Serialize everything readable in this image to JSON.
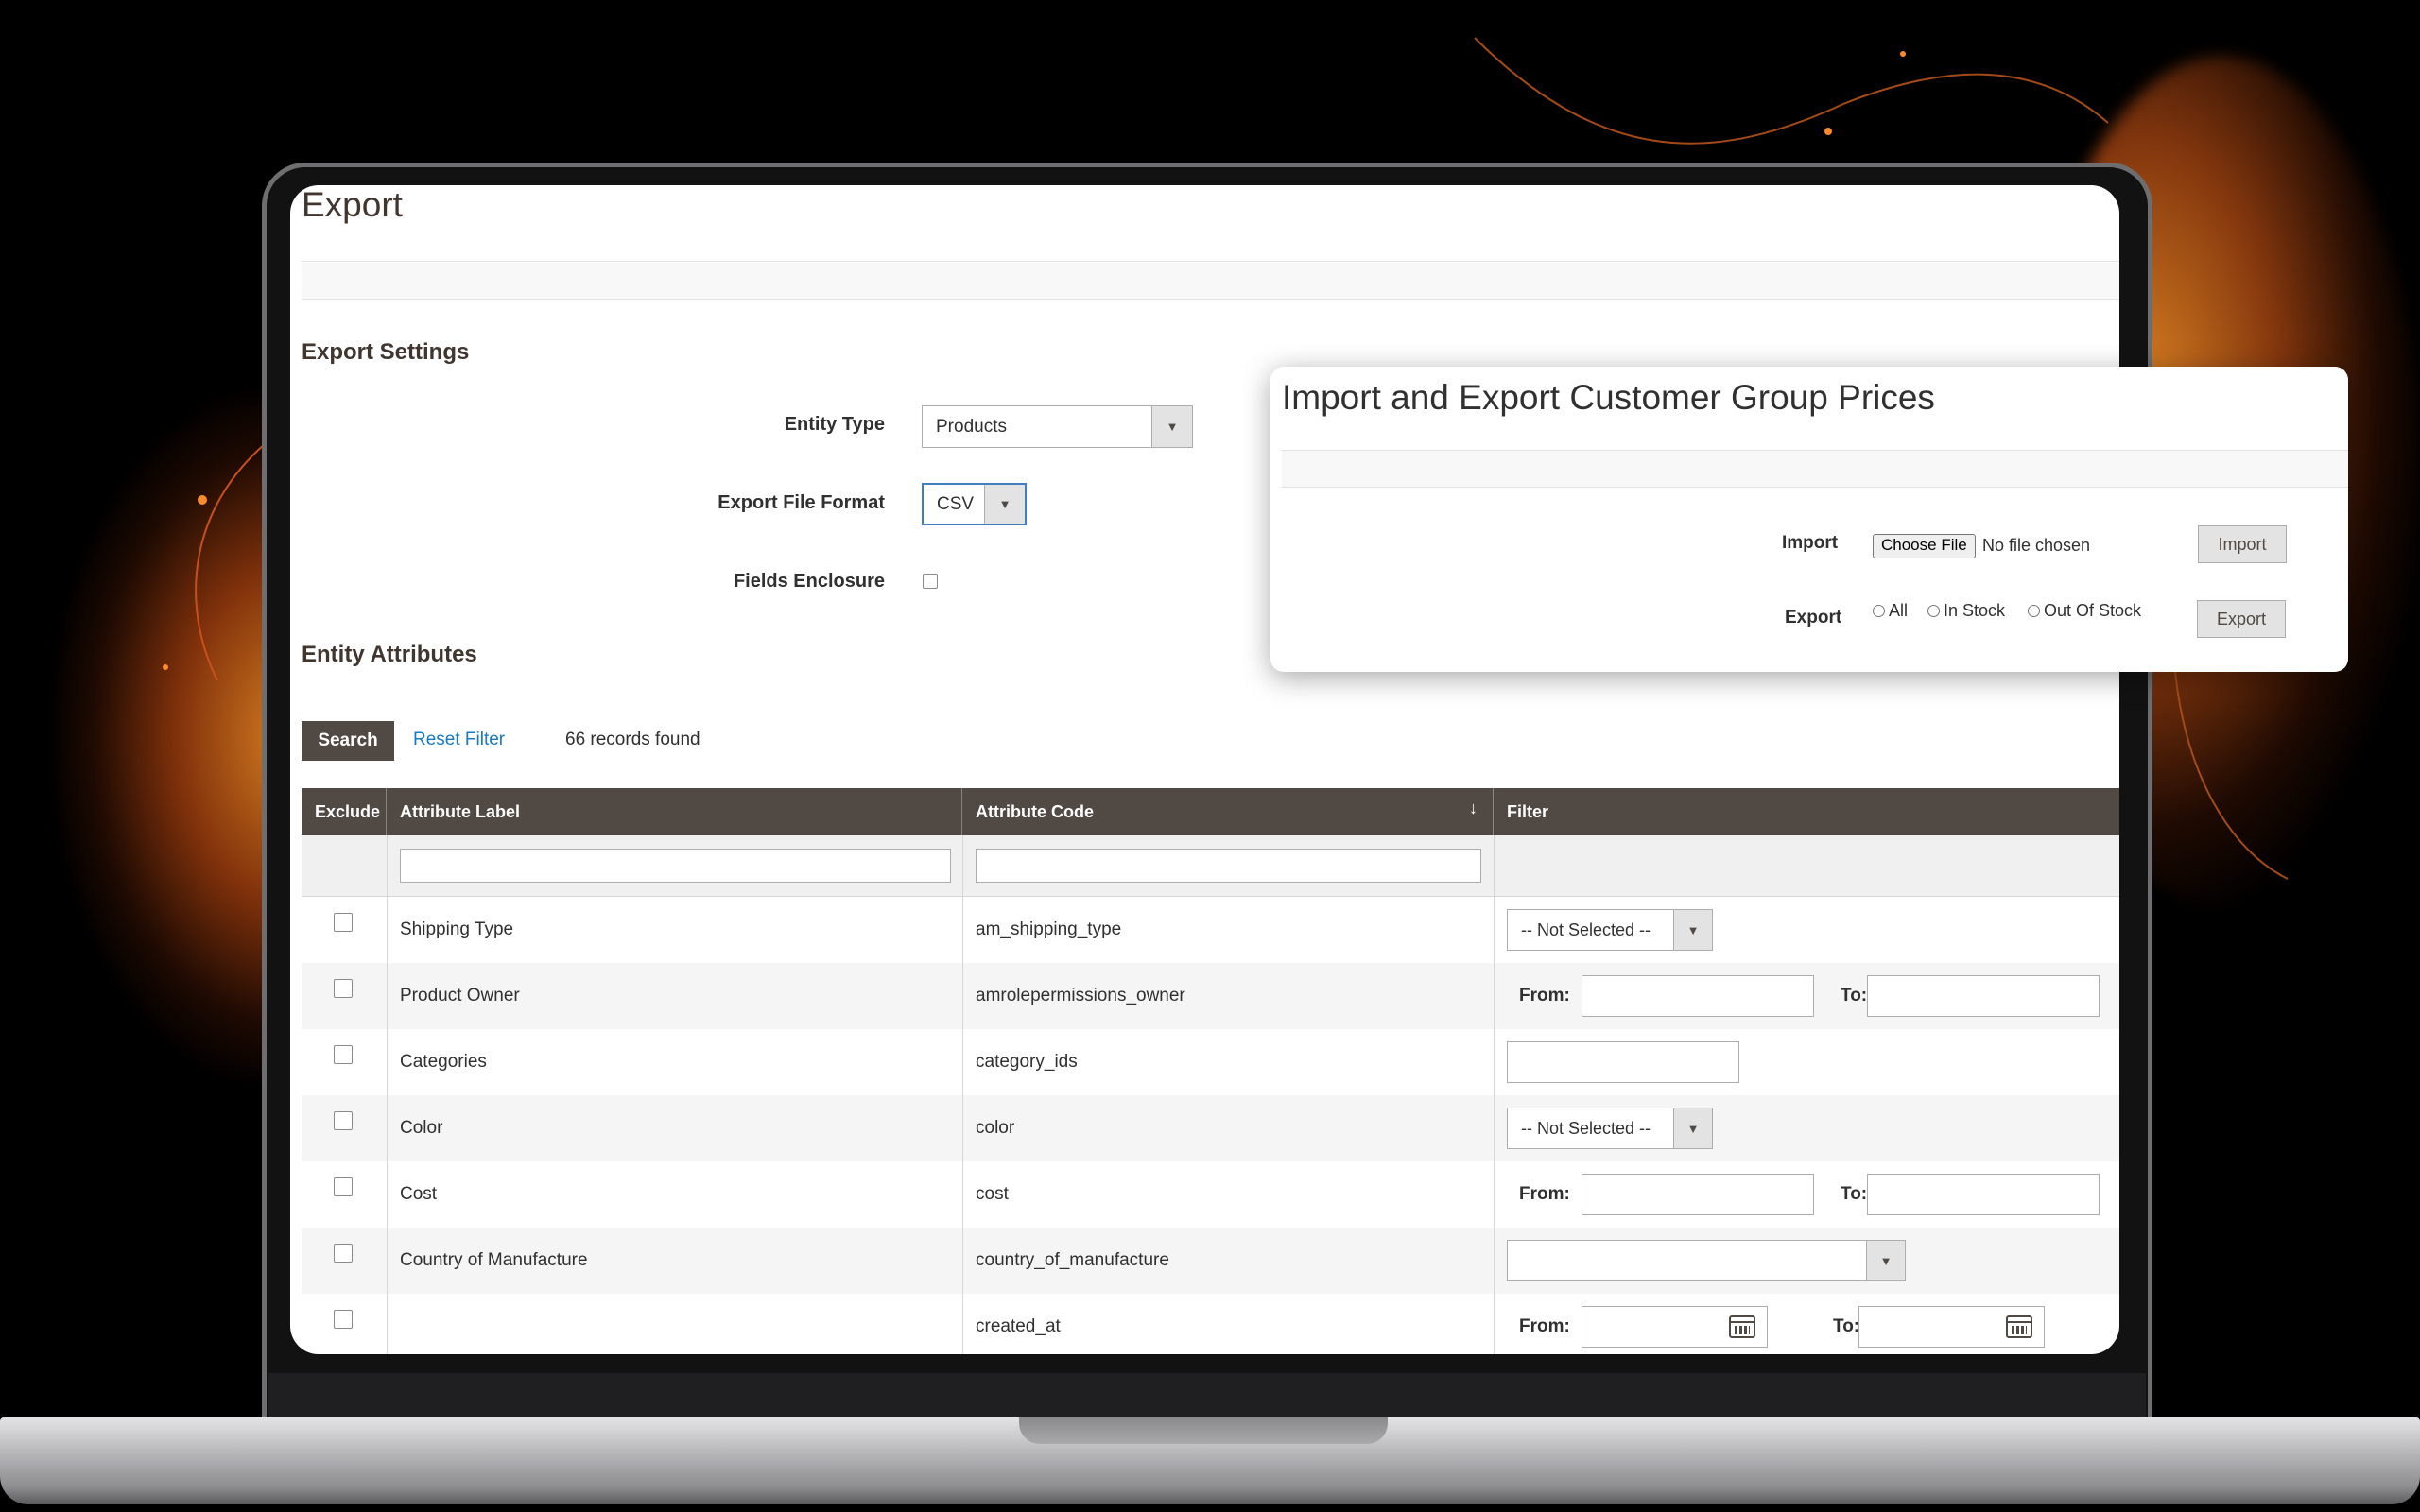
{
  "page": {
    "title": "Export",
    "export_settings_title": "Export Settings",
    "entity_type_label": "Entity Type",
    "entity_type_value": "Products",
    "file_format_label": "Export File Format",
    "file_format_value": "CSV",
    "fields_enclosure_label": "Fields Enclosure",
    "entity_attributes_title": "Entity Attributes",
    "search_label": "Search",
    "reset_filter_label": "Reset Filter",
    "records_found": "66 records found"
  },
  "grid": {
    "columns": [
      "Exclude",
      "Attribute Label",
      "Attribute Code",
      "Filter"
    ],
    "sort_indicator": "↓",
    "from_label": "From:",
    "to_label": "To:",
    "not_selected": "-- Not Selected --",
    "rows": [
      {
        "label": "Shipping Type",
        "code": "am_shipping_type"
      },
      {
        "label": "Product Owner",
        "code": "amrolepermissions_owner"
      },
      {
        "label": "Categories",
        "code": "category_ids"
      },
      {
        "label": "Color",
        "code": "color"
      },
      {
        "label": "Cost",
        "code": "cost"
      },
      {
        "label": "Country of Manufacture",
        "code": "country_of_manufacture"
      },
      {
        "label": "",
        "code": "created_at"
      }
    ]
  },
  "overlay": {
    "title": "Import and Export Customer Group Prices",
    "import_label": "Import",
    "choose_file_label": "Choose File",
    "no_file_text": "No file chosen",
    "import_button": "Import",
    "export_label": "Export",
    "radio_all": "All",
    "radio_in_stock": "In Stock",
    "radio_out_of_stock": "Out Of Stock",
    "export_button": "Export"
  },
  "colors": {
    "header_bg": "#514943",
    "link": "#1979c3",
    "accent_glow": "#f07a1e"
  }
}
